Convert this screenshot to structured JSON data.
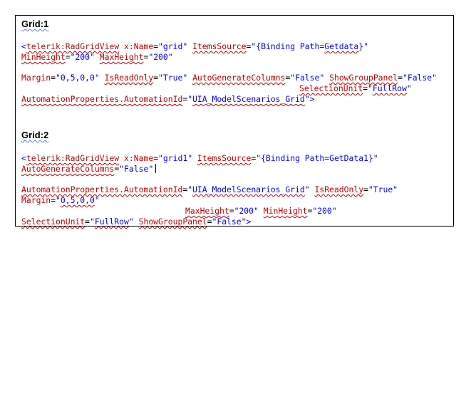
{
  "grid1": {
    "heading": "Grid:1",
    "line1": {
      "open": "<",
      "tag": "telerik:RadGridView",
      "name_attr": " x:Name",
      "name_eq": "=",
      "name_val": "\"grid\"",
      "src_attr": "ItemsSource",
      "src_eq": "=",
      "src_val_a": "\"{Binding Path=",
      "src_val_b": "Getdata",
      "src_val_c": "}\""
    },
    "line2": {
      "minh_attr": "MinHeight",
      "minh_eq": "=",
      "minh_val": "\"200\"",
      "maxh_attr": "MaxHeight",
      "maxh_eq": "=",
      "maxh_val": "\"200\""
    },
    "line3": {
      "margin_attr": "Margin",
      "margin_eq": "=",
      "margin_val": "\"0,5,0,0\"",
      "ro_attr": "IsReadOnly",
      "ro_eq": "=",
      "ro_val": "\"True\"",
      "agc_attr": "AutoGenerateColumns",
      "agc_eq": "=",
      "agc_val": "\"False\"",
      "sgp_attr": "ShowGroupPanel",
      "sgp_eq": "=",
      "sgp_val": "\"False\""
    },
    "line4": {
      "su_attr": "SelectionUnit",
      "su_eq": "=",
      "su_val_a": "\"",
      "su_val_b": "FullRow",
      "su_val_c": "\""
    },
    "line5": {
      "ap_attr": "AutomationProperties.AutomationId",
      "ap_eq": "=",
      "ap_val_a": "\"",
      "ap_val_b": "UIA_ModelScenarios_Grid",
      "ap_val_c": "\"",
      "close": ">"
    }
  },
  "grid2": {
    "heading": "Grid:2",
    "line1": {
      "open": "<",
      "tag": "telerik:RadGridView",
      "name_attr": " x:Name",
      "name_eq": "=",
      "name_val": "\"grid1\"",
      "src_attr": "ItemsSource",
      "src_eq": "=",
      "src_val": "\"{Binding Path=GetData1}\""
    },
    "line2": {
      "agc_attr": "AutoGenerateColumns",
      "agc_eq": "=",
      "agc_val": "\"False\""
    },
    "line3": {
      "ap_attr": "AutomationProperties.AutomationId",
      "ap_eq": "=",
      "ap_val_a": "\"",
      "ap_val_b": "UIA_ModelScenarios_Grid",
      "ap_val_c": "\"",
      "ro_attr": "IsReadOnly",
      "ro_eq": "=",
      "ro_val": "\"True\""
    },
    "line4": {
      "margin_attr": "Margin",
      "margin_eq": "=",
      "margin_val_a": "\"",
      "margin_val_b": "0,5,0,0",
      "margin_val_c": "\""
    },
    "line5": {
      "maxh_attr": "MaxHeight",
      "maxh_eq": "=",
      "maxh_val": "\"200\"",
      "minh_attr": "MinHeight",
      "minh_eq": "=",
      "minh_val": "\"200\""
    },
    "line6": {
      "su_attr": "SelectionUnit",
      "su_eq": "=",
      "su_val_a": "\"",
      "su_val_b": "FullRow",
      "su_val_c": "\"",
      "sgp_attr": "ShowGroupPanel",
      "sgp_eq": "=",
      "sgp_val": "\"False\"",
      "close": ">"
    }
  },
  "colors": {
    "tag": "#a31515",
    "attribute": "#c00000",
    "value": "#0000ff",
    "squiggle": "#c00000"
  }
}
